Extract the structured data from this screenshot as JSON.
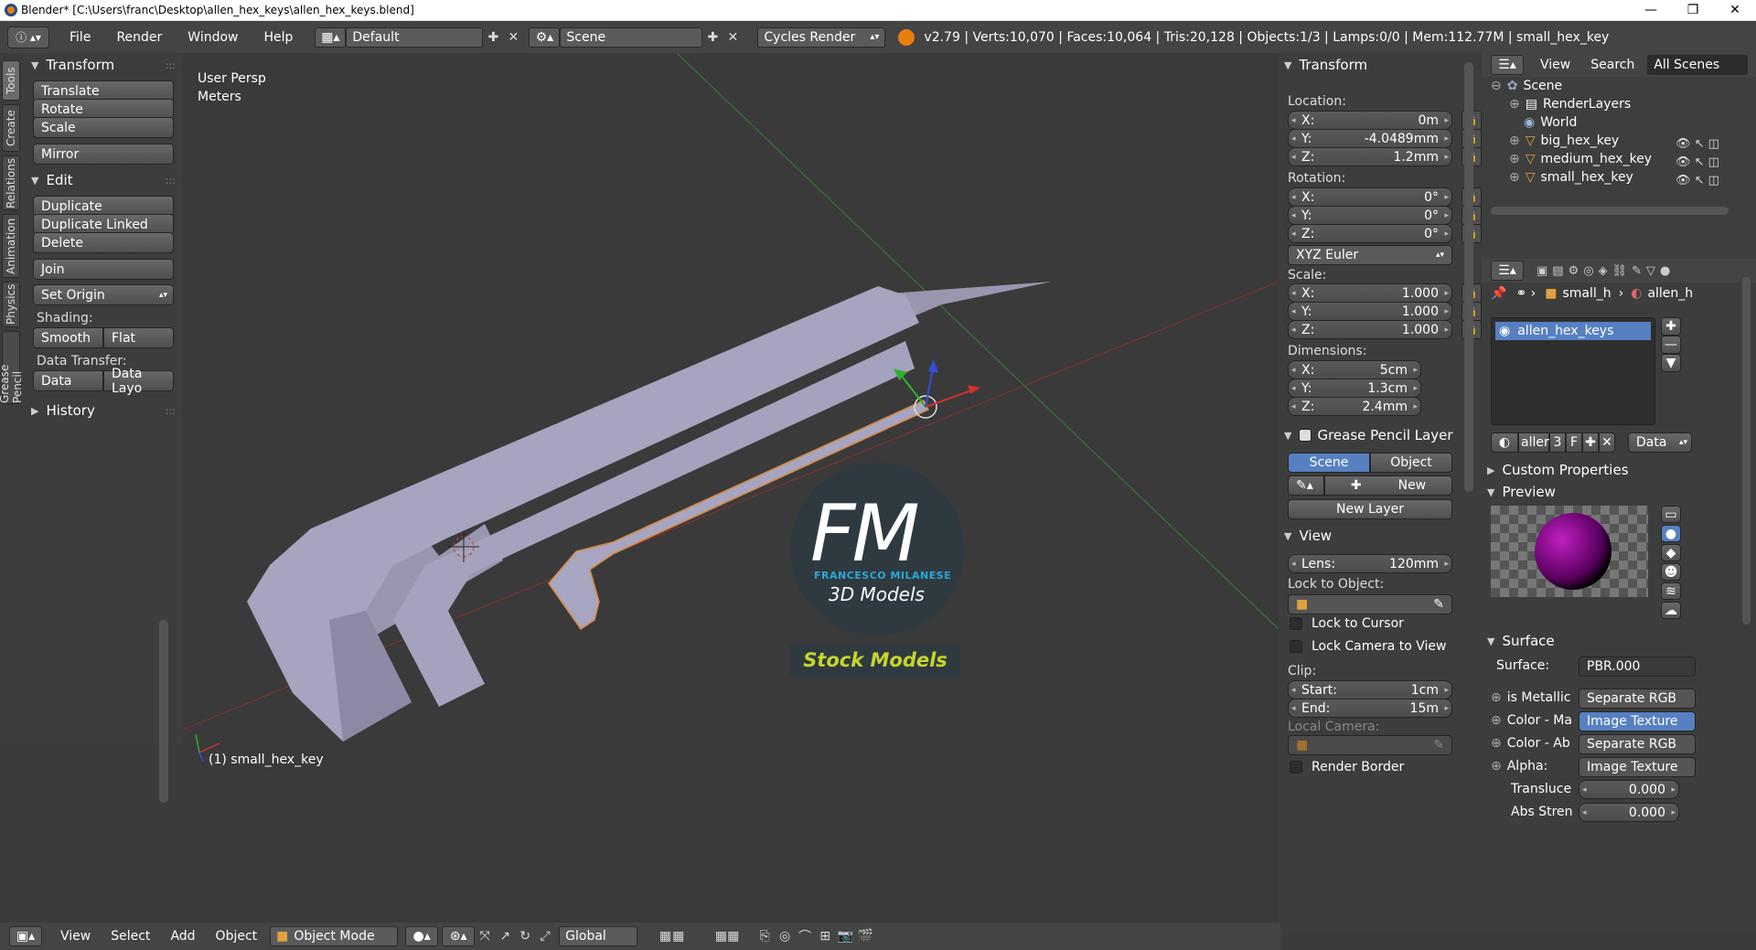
{
  "window": {
    "title": "Blender* [C:\\Users\\franc\\Desktop\\allen_hex_keys\\allen_hex_keys.blend]",
    "minimize": "—",
    "maximize": "❐",
    "close": "✕"
  },
  "topbar": {
    "menus": [
      "File",
      "Render",
      "Window",
      "Help"
    ],
    "screen_layout": "Default",
    "scene": "Scene",
    "render_engine": "Cycles Render",
    "stats": "v2.79 | Verts:10,070 | Faces:10,064 | Tris:20,128 | Objects:1/3 | Lamps:0/0 | Mem:112.77M | small_hex_key"
  },
  "vtabs": [
    "Tools",
    "Create",
    "Relations",
    "Animation",
    "Physics",
    "Grease Pencil"
  ],
  "toolshelf": {
    "transform_header": "Transform",
    "translate": "Translate",
    "rotate": "Rotate",
    "scale": "Scale",
    "mirror": "Mirror",
    "edit_header": "Edit",
    "duplicate": "Duplicate",
    "duplicate_linked": "Duplicate Linked",
    "delete": "Delete",
    "join": "Join",
    "set_origin": "Set Origin",
    "shading_label": "Shading:",
    "smooth": "Smooth",
    "flat": "Flat",
    "data_transfer_label": "Data Transfer:",
    "data": "Data",
    "data_layout": "Data Layo",
    "history_header": "History"
  },
  "viewport": {
    "view_name": "User Persp",
    "units": "Meters",
    "object_label": "(1) small_hex_key",
    "logo_fm": "FM",
    "logo_name": "FRANCESCO MILANESE",
    "logo_sub": "3D Models",
    "logo_stock": "Stock Models"
  },
  "npanel": {
    "transform_header": "Transform",
    "location_label": "Location:",
    "loc_x": "0m",
    "loc_y": "-4.0489mm",
    "loc_z": "1.2mm",
    "rotation_label": "Rotation:",
    "rot_x": "0°",
    "rot_y": "0°",
    "rot_z": "0°",
    "rotation_mode": "XYZ Euler",
    "scale_label": "Scale:",
    "scale_x": "1.000",
    "scale_y": "1.000",
    "scale_z": "1.000",
    "dimensions_label": "Dimensions:",
    "dim_x": "5cm",
    "dim_y": "1.3cm",
    "dim_z": "2.4mm",
    "gp_header": "Grease Pencil Layer",
    "gp_scene": "Scene",
    "gp_object": "Object",
    "gp_new": "New",
    "gp_new_layer": "New Layer",
    "view_header": "View",
    "lens_label": "Lens:",
    "lens": "120mm",
    "lock_to_object": "Lock to Object:",
    "lock_to_cursor": "Lock to Cursor",
    "lock_camera": "Lock Camera to View",
    "clip_label": "Clip:",
    "clip_start_label": "Start:",
    "clip_start": "1cm",
    "clip_end_label": "End:",
    "clip_end": "15m",
    "local_camera": "Local Camera:",
    "render_border": "Render Border"
  },
  "outliner": {
    "view": "View",
    "search": "Search",
    "filter": "All Scenes",
    "items": [
      "Scene",
      "RenderLayers",
      "World",
      "big_hex_key",
      "medium_hex_key",
      "small_hex_key"
    ]
  },
  "properties": {
    "breadcrumb_object": "small_h",
    "breadcrumb_material": "allen_h",
    "material_slot": "allen_hex_keys",
    "mat_name": "allen",
    "mat_users": "3",
    "mat_fake": "F",
    "mat_link": "Data",
    "custom_props": "Custom Properties",
    "preview": "Preview",
    "surface_header": "Surface",
    "surface_label": "Surface:",
    "surface_value": "PBR.000",
    "inputs": [
      {
        "label": "is Metallic",
        "value": "Separate RGB"
      },
      {
        "label": "Color - Ma",
        "value": "Image Texture"
      },
      {
        "label": "Color - Ab",
        "value": "Separate RGB"
      },
      {
        "label": "Alpha:",
        "value": "Image Texture"
      }
    ],
    "translucence_label": "Transluce",
    "translucence": "0.000",
    "abs_strength_label": "Abs Stren",
    "abs_strength": "0.000"
  },
  "bottom": {
    "view": "View",
    "select": "Select",
    "add": "Add",
    "object": "Object",
    "mode": "Object Mode",
    "orientation": "Global"
  }
}
